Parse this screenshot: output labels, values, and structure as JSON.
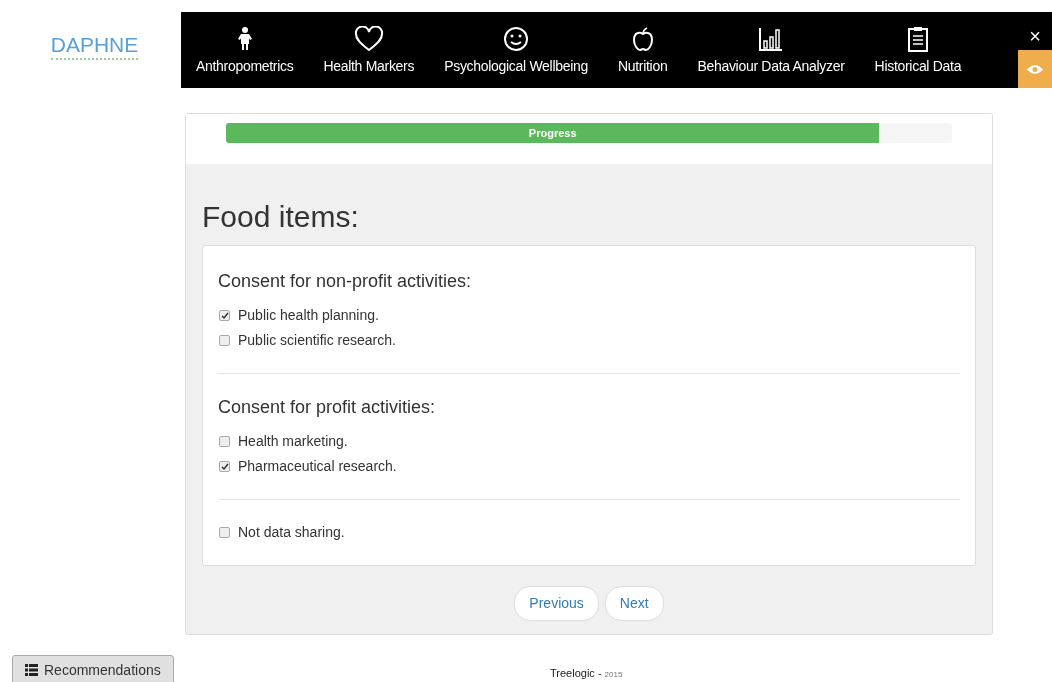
{
  "logo": {
    "text": "DAPHNE"
  },
  "nav": [
    {
      "label": "Anthropometrics"
    },
    {
      "label": "Health Markers"
    },
    {
      "label": "Psychological Wellbeing"
    },
    {
      "label": "Nutrition"
    },
    {
      "label": "Behaviour Data Analyzer"
    },
    {
      "label": "Historical Data"
    }
  ],
  "close": "×",
  "progress": {
    "label": "Progress",
    "level": 0.9
  },
  "title": "Food items:",
  "groups": [
    {
      "heading": "Consent for non-profit activities:",
      "options": [
        {
          "label": "Public health planning.",
          "checked": true
        },
        {
          "label": "Public scientific research.",
          "checked": false
        }
      ]
    },
    {
      "heading": "Consent for profit activities:",
      "options": [
        {
          "label": "Health marketing.",
          "checked": false
        },
        {
          "label": "Pharmaceutical research.",
          "checked": true
        }
      ]
    },
    {
      "options": [
        {
          "label": "Not data sharing.",
          "checked": false
        }
      ]
    }
  ],
  "buttons": [
    "Previous",
    "Next"
  ],
  "recommendations": "Recommendations",
  "footer": {
    "company": "Treelogic -",
    "year": "2015"
  }
}
